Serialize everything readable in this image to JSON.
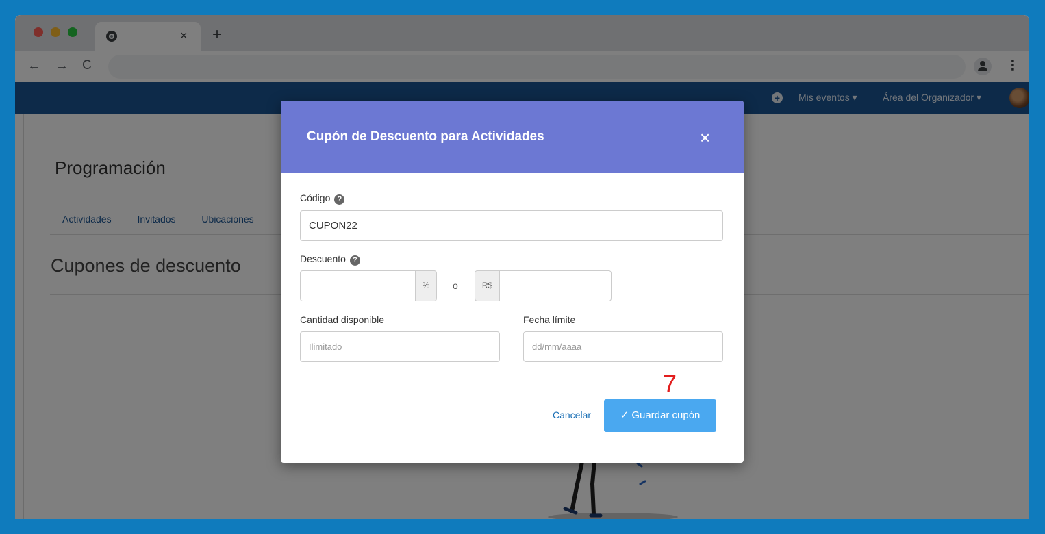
{
  "browser": {
    "tab_close": "×",
    "new_tab": "+",
    "nav": {
      "back": "←",
      "forward": "→",
      "reload": "C"
    },
    "star": "☆",
    "menu": "⋮"
  },
  "appbar": {
    "add_icon": "+",
    "links": [
      "Mis eventos ▾",
      "Área del Organizador ▾"
    ]
  },
  "page": {
    "title": "Programación",
    "tabs": [
      "Actividades",
      "Invitados",
      "Ubicaciones"
    ],
    "section_title": "Cupones de descuento"
  },
  "modal": {
    "title": "Cupón de Descuento para Actividades",
    "close": "×",
    "codigo": {
      "label": "Código",
      "value": "CUPON22"
    },
    "descuento": {
      "label": "Descuento",
      "percent_addon": "%",
      "or": "o",
      "currency_addon": "R$"
    },
    "cantidad": {
      "label": "Cantidad disponible",
      "placeholder": "Ilimitado"
    },
    "fecha": {
      "label": "Fecha límite",
      "placeholder": "dd/mm/aaaa"
    },
    "help": "?",
    "step_marker": "7",
    "cancel": "Cancelar",
    "save": "✓  Guardar cupón"
  },
  "colors": {
    "desktop": "#0f7bbd",
    "appbar": "#1a5593",
    "modal_header": "#6c78d3",
    "save_button": "#4aa8f0",
    "step_marker": "#e21e1e"
  }
}
